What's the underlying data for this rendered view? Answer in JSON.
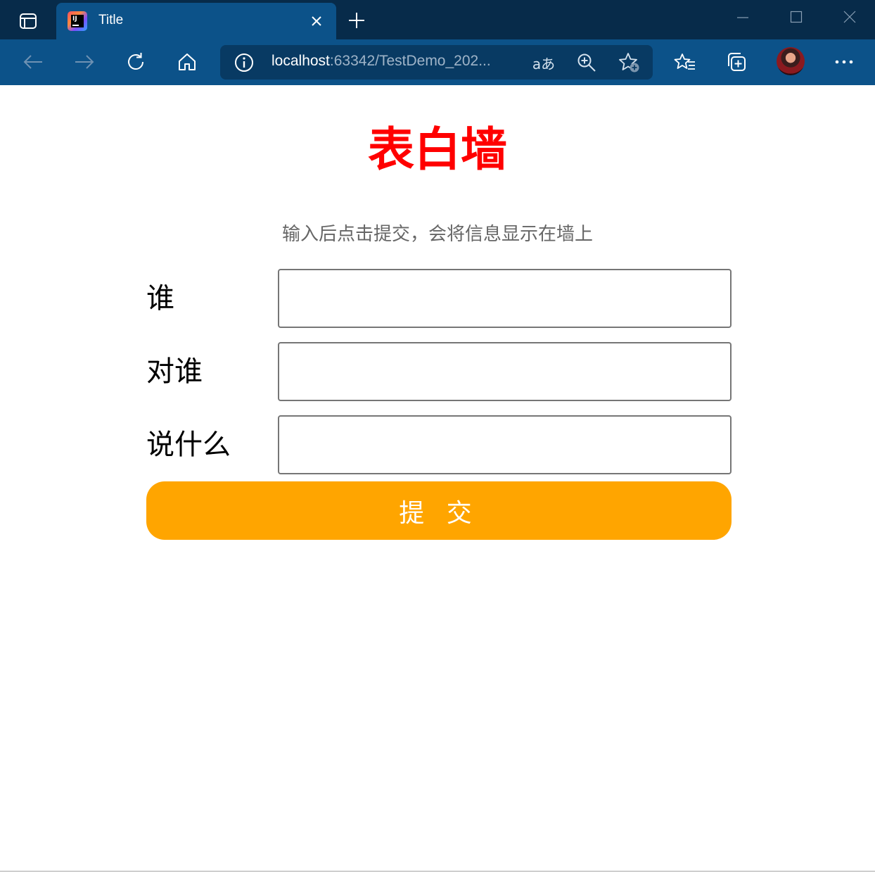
{
  "browser": {
    "tab_title": "Title",
    "address": {
      "host": "localhost",
      "rest": ":63342/TestDemo_202..."
    },
    "read_aloud_label": "aあ"
  },
  "page": {
    "heading": "表白墙",
    "hint": "输入后点击提交，会将信息显示在墙上",
    "form": {
      "fields": [
        {
          "label": "谁",
          "value": ""
        },
        {
          "label": "对谁",
          "value": ""
        },
        {
          "label": "说什么",
          "value": ""
        }
      ],
      "submit_label": "提 交"
    }
  },
  "colors": {
    "heading": "#ff0000",
    "hint": "#666666",
    "submit_bg": "#ffa500",
    "chrome_tab": "#0c5289",
    "chrome_titlebar": "#072b4a"
  }
}
